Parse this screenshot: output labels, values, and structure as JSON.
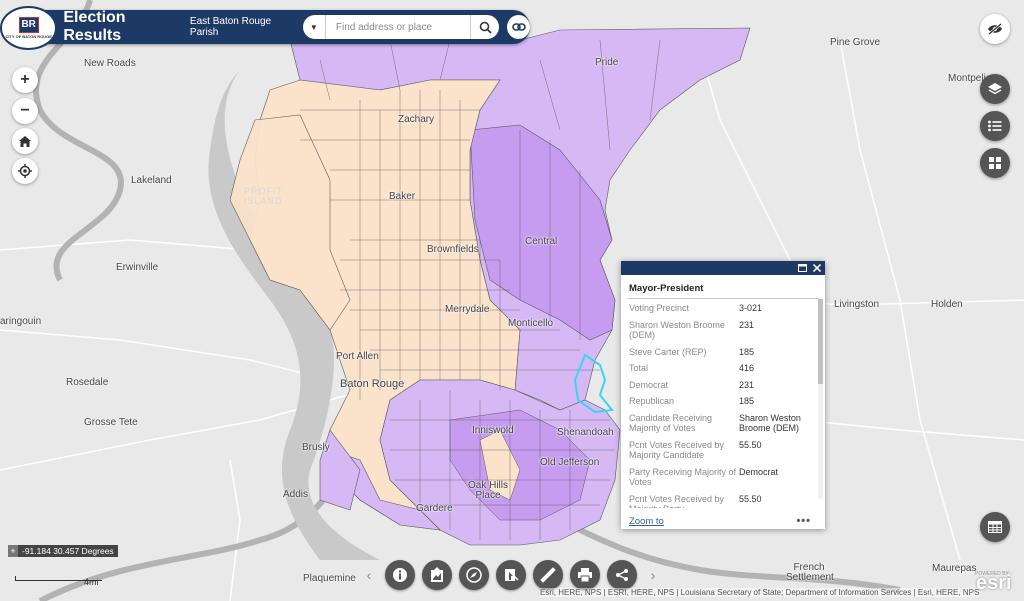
{
  "header": {
    "logo_badge": "BR",
    "logo_text": "CITY OF BATON ROUGE",
    "title": "Election Results",
    "subtitle": "East Baton Rouge Parish",
    "search_placeholder": "Find address or place"
  },
  "map": {
    "colors": {
      "background": "#e9e9e9",
      "democrat_precincts": "#fae2cb",
      "republican_precincts": "#d6b8f5",
      "republican_strong": "#c69cf0",
      "precinct_border": "#5a5a5a",
      "selected_precinct": "#36d7f2",
      "water": "#b3b3b3"
    },
    "places": [
      {
        "name": "New Roads",
        "id": "new-roads"
      },
      {
        "name": "Pine Grove",
        "id": "pine-grove"
      },
      {
        "name": "Pride",
        "id": "pride"
      },
      {
        "name": "Montpelier",
        "id": "montpelier"
      },
      {
        "name": "Zachary",
        "id": "zachary"
      },
      {
        "name": "Lakeland",
        "id": "lakeland"
      },
      {
        "name": "Baker",
        "id": "baker"
      },
      {
        "name": "Central",
        "id": "central"
      },
      {
        "name": "Brownfields",
        "id": "brownfields"
      },
      {
        "name": "Erwinville",
        "id": "erwinville"
      },
      {
        "name": "Livingston",
        "id": "livingston"
      },
      {
        "name": "Holden",
        "id": "holden"
      },
      {
        "name": "Merrydale",
        "id": "merrydale"
      },
      {
        "name": "Monticello",
        "id": "monticello"
      },
      {
        "name": "aringouin",
        "id": "maringouin"
      },
      {
        "name": "Port Allen",
        "id": "port-allen"
      },
      {
        "name": "Baton Rouge",
        "id": "baton-rouge"
      },
      {
        "name": "Rosedale",
        "id": "rosedale"
      },
      {
        "name": "Grosse Tete",
        "id": "grosse-tete"
      },
      {
        "name": "Inniswold",
        "id": "inniswold"
      },
      {
        "name": "Shenandoah",
        "id": "shenandoah"
      },
      {
        "name": "Brusly",
        "id": "brusly"
      },
      {
        "name": "Old Jefferson",
        "id": "old-jefferson"
      },
      {
        "name": "Addis",
        "id": "addis"
      },
      {
        "name": "Oak Hills Place",
        "id": "oak-hills-place"
      },
      {
        "name": "Gardere",
        "id": "gardere"
      },
      {
        "name": "Plaquemine",
        "id": "plaquemine"
      },
      {
        "name": "French Settlement",
        "id": "french-settlement"
      },
      {
        "name": "Maurepas",
        "id": "maurepas"
      }
    ],
    "island_label": "PROFIT ISLAND"
  },
  "popup": {
    "title": "Mayor-President",
    "rows": [
      {
        "key": "Voting Precinct",
        "value": "3-021"
      },
      {
        "key": "Sharon Weston Broome (DEM)",
        "value": "231"
      },
      {
        "key": "Steve Carter (REP)",
        "value": "185"
      },
      {
        "key": "Total",
        "value": "416"
      },
      {
        "key": "Democrat",
        "value": "231"
      },
      {
        "key": "Republican",
        "value": "185"
      },
      {
        "key": "Candidate Receiving Majority of Votes",
        "value": "Sharon Weston Broome (DEM)"
      },
      {
        "key": "Pcnt Votes Received by Majority Candidate",
        "value": "55.50"
      },
      {
        "key": "Party Receiving Majority of Votes",
        "value": "Democrat"
      },
      {
        "key": "Pcnt Votes Received by Majority Party",
        "value": "55.50"
      }
    ],
    "zoom_link": "Zoom to",
    "more": "•••"
  },
  "coordinates": "-91.184 30.457 Degrees",
  "scale_label": "4mi",
  "attribution": "Esri, HERE, NPS | ESRI, HERE, NPS | Louisiana Secretary of State; Department of Information Services | Esri, HERE, NPS",
  "esri_logo": "esri",
  "esri_powered": "POWERED BY",
  "toolbar": [
    {
      "icon": "info-icon"
    },
    {
      "icon": "basemap-gallery-icon"
    },
    {
      "icon": "compass-icon"
    },
    {
      "icon": "directions-icon"
    },
    {
      "icon": "measure-icon"
    },
    {
      "icon": "print-icon"
    },
    {
      "icon": "share-icon"
    }
  ]
}
